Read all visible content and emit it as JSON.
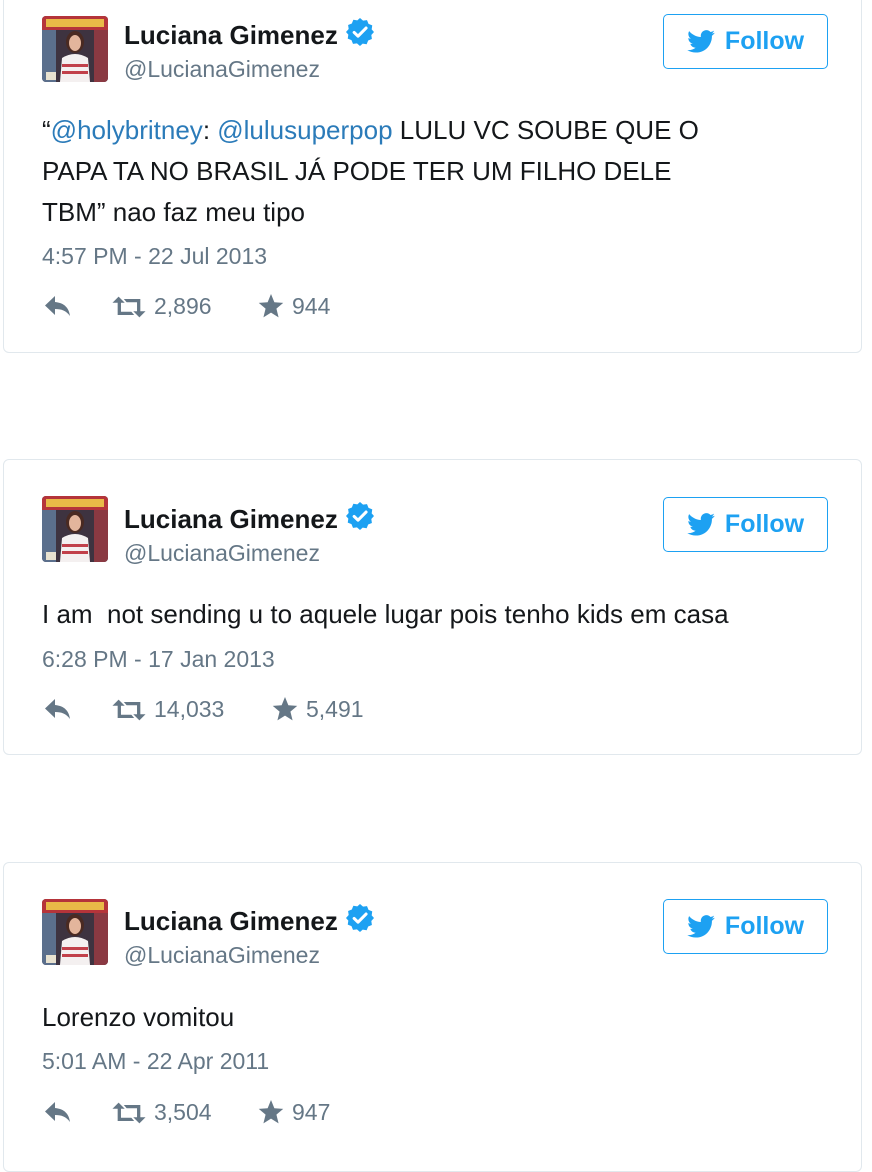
{
  "colors": {
    "accent": "#1da1f2",
    "mention": "#2b7bb9",
    "muted": "#657786",
    "verified": "#1da1f2",
    "border": "#e1e8ed"
  },
  "icons": {
    "follow": "twitter-bird-icon",
    "reply": "reply-icon",
    "retweet": "retweet-icon",
    "like": "star-icon",
    "verified": "verified-badge-icon"
  },
  "tweets": [
    {
      "name": "Luciana Gimenez",
      "handle": "@LucianaGimenez",
      "follow_label": "Follow",
      "text": {
        "open_quote": "“",
        "mention1": "@holybritney",
        "sep": ": ",
        "mention2": "@lulusuperpop",
        "line1_rest": " LULU VC SOUBE QUE O",
        "line2": "PAPA TA NO BRASIL JÁ PODE TER UM FILHO DELE",
        "line3": "TBM” nao faz meu tipo"
      },
      "timestamp": "4:57 PM - 22 Jul 2013",
      "retweets": "2,896",
      "likes": "944"
    },
    {
      "name": "Luciana Gimenez",
      "handle": "@LucianaGimenez",
      "follow_label": "Follow",
      "text": {
        "line1": "I am  not sending u to aquele lugar pois tenho kids em casa"
      },
      "timestamp": "6:28 PM - 17 Jan 2013",
      "retweets": "14,033",
      "likes": "5,491"
    },
    {
      "name": "Luciana Gimenez",
      "handle": "@LucianaGimenez",
      "follow_label": "Follow",
      "text": {
        "line1": "Lorenzo vomitou"
      },
      "timestamp": "5:01 AM - 22 Apr 2011",
      "retweets": "3,504",
      "likes": "947"
    }
  ]
}
